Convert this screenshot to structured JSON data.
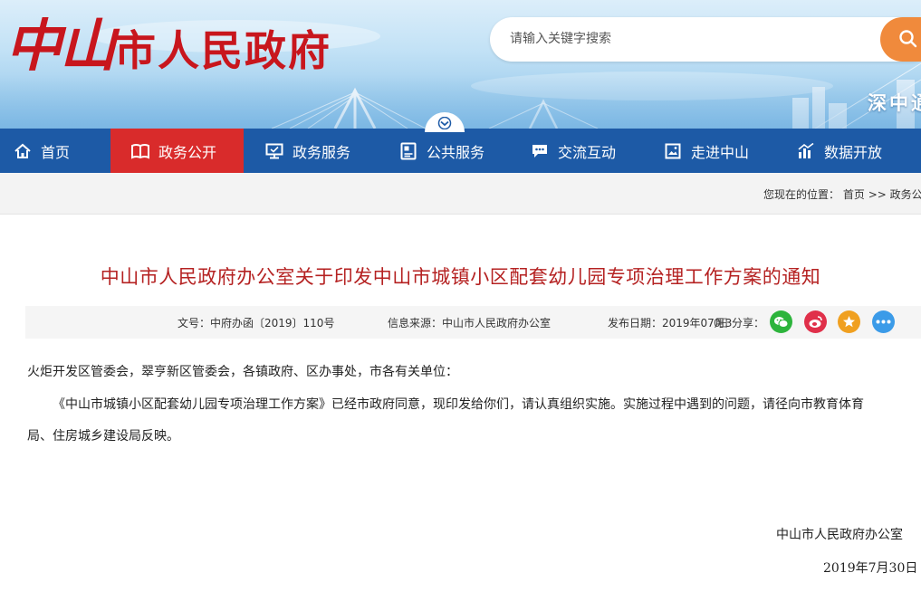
{
  "header": {
    "site_title_first": "中山",
    "site_title_rest": "市人民政府",
    "search": {
      "placeholder": "请输入关键字搜索"
    },
    "slogan": "深中通",
    "colors": {
      "title": "#c8161d",
      "search_button": "#f08a3c",
      "sky": "#a7d2ef"
    }
  },
  "nav": {
    "active": "政务公开",
    "items": [
      {
        "label": "首页",
        "icon": "home-icon"
      },
      {
        "label": "政务公开",
        "icon": "book-icon"
      },
      {
        "label": "政务服务",
        "icon": "monitor-icon"
      },
      {
        "label": "公共服务",
        "icon": "id-card-icon"
      },
      {
        "label": "交流互动",
        "icon": "chat-icon"
      },
      {
        "label": "走进中山",
        "icon": "image-icon"
      },
      {
        "label": "数据开放",
        "icon": "bar-chart-icon"
      }
    ],
    "colors": {
      "background": "#1d5aa6",
      "active": "#d92b2b"
    }
  },
  "breadcrumb": {
    "prefix": "您现在的位置：",
    "home": "首页",
    "separator": ">>",
    "current": "政务公"
  },
  "article": {
    "title": "中山市人民政府办公室关于印发中山市城镇小区配套幼儿园专项治理工作方案的通知",
    "meta": {
      "doc_number": "文号：中府办函〔2019〕110号",
      "source": "信息来源：中山市人民政府办公室",
      "publish_date": "发布日期：2019年07月3",
      "share_overlap": "0日",
      "share_label": "分享："
    },
    "share_icons": [
      "wechat-icon",
      "weibo-icon",
      "favorite-icon",
      "more-icon"
    ],
    "salutation": "火炬开发区管委会，翠亨新区管委会，各镇政府、区办事处，市各有关单位：",
    "paragraph_line1": "《中山市城镇小区配套幼儿园专项治理工作方案》已经市政府同意，现印发给你们，请认真组织实施。实施过程中遇到的问题，请径向市教育体育",
    "paragraph_line2": "局、住房城乡建设局反映。",
    "signature_org": "中山市人民政府办公室",
    "signature_date": "2019年7月30日",
    "title_color": "#b52222"
  }
}
